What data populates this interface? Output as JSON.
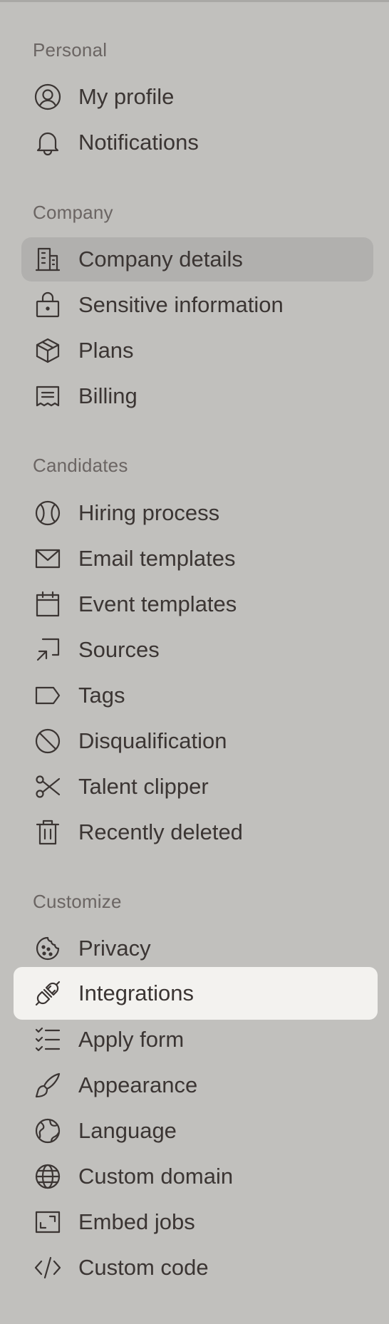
{
  "sections": {
    "personal": {
      "title": "Personal",
      "items": [
        {
          "label": "My profile",
          "icon": "user-circle-icon"
        },
        {
          "label": "Notifications",
          "icon": "bell-icon"
        }
      ]
    },
    "company": {
      "title": "Company",
      "items": [
        {
          "label": "Company details",
          "icon": "building-icon",
          "state": "selected"
        },
        {
          "label": "Sensitive information",
          "icon": "lock-icon"
        },
        {
          "label": "Plans",
          "icon": "package-icon"
        },
        {
          "label": "Billing",
          "icon": "receipt-icon"
        }
      ]
    },
    "candidates": {
      "title": "Candidates",
      "items": [
        {
          "label": "Hiring process",
          "icon": "baseball-icon"
        },
        {
          "label": "Email templates",
          "icon": "envelope-icon"
        },
        {
          "label": "Event templates",
          "icon": "calendar-icon"
        },
        {
          "label": "Sources",
          "icon": "arrow-square-in-icon"
        },
        {
          "label": "Tags",
          "icon": "tag-icon"
        },
        {
          "label": "Disqualification",
          "icon": "prohibit-icon"
        },
        {
          "label": "Talent clipper",
          "icon": "scissors-icon"
        },
        {
          "label": "Recently deleted",
          "icon": "trash-icon"
        }
      ]
    },
    "customize": {
      "title": "Customize",
      "items": [
        {
          "label": "Privacy",
          "icon": "cookie-icon"
        },
        {
          "label": "Integrations",
          "icon": "plug-icon",
          "state": "hovered"
        },
        {
          "label": "Apply form",
          "icon": "checklist-icon"
        },
        {
          "label": "Appearance",
          "icon": "paint-brush-icon"
        },
        {
          "label": "Language",
          "icon": "globe-stand-icon"
        },
        {
          "label": "Custom domain",
          "icon": "globe-icon"
        },
        {
          "label": "Embed jobs",
          "icon": "frame-corners-icon"
        },
        {
          "label": "Custom code",
          "icon": "code-icon"
        }
      ]
    }
  }
}
